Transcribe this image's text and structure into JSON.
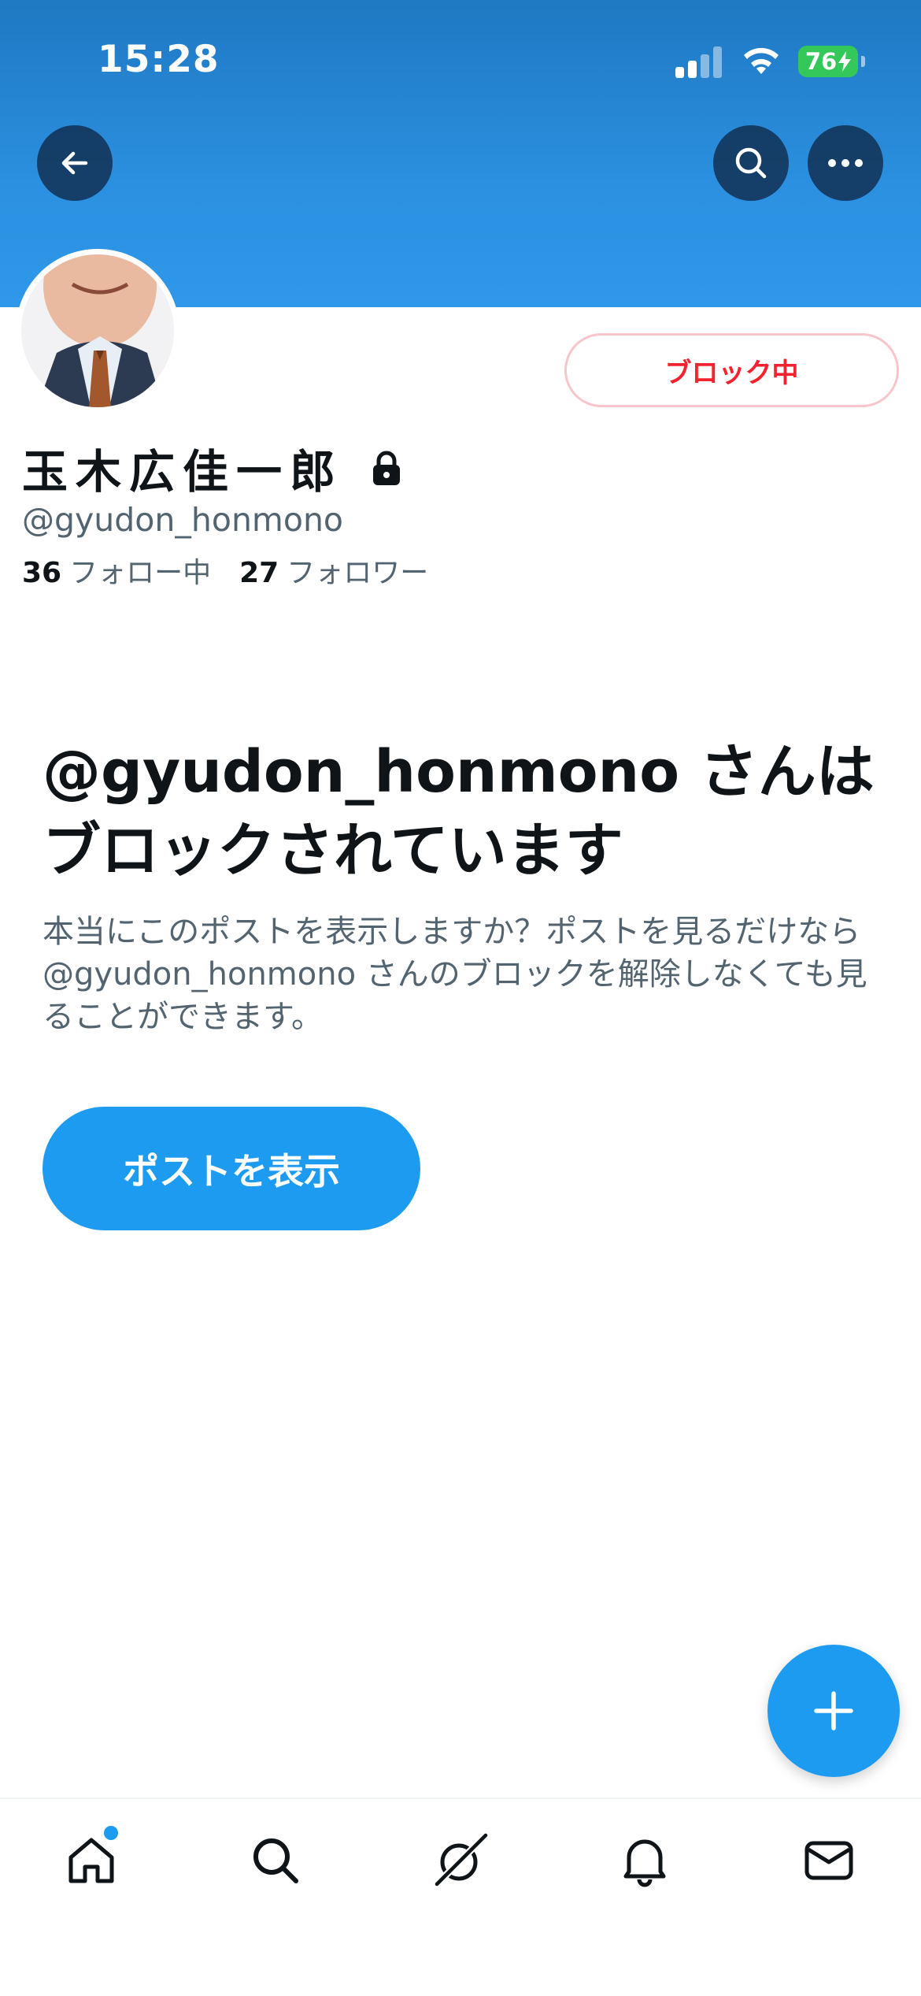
{
  "status_bar": {
    "time": "15:28",
    "battery": "76"
  },
  "header": {
    "back_icon": "arrow-left-icon",
    "search_icon": "search-icon",
    "more_icon": "more-horizontal-icon",
    "banner_color": "#2b90e0"
  },
  "profile": {
    "display_name": "玉木広佳一郎",
    "handle": "@gyudon_honmono",
    "following_count": "36",
    "following_label": "フォロー中",
    "followers_count": "27",
    "followers_label": "フォロワー",
    "protected_icon": "lock-icon",
    "blocked_button_label": "ブロック中"
  },
  "blocked_notice": {
    "title": "@gyudon_honmono さんはブロックされています",
    "description": "本当にこのポストを表示しますか？ポストを見るだけなら @gyudon_honmono さんのブロックを解除しなくても見ることができます。",
    "button_label": "ポストを表示"
  },
  "fab": {
    "icon": "plus-icon"
  },
  "tab_bar": {
    "items": [
      {
        "name": "home",
        "icon": "home-icon",
        "has_badge": true
      },
      {
        "name": "search",
        "icon": "search-icon"
      },
      {
        "name": "grok",
        "icon": "grok-icon"
      },
      {
        "name": "notifications",
        "icon": "bell-icon"
      },
      {
        "name": "messages",
        "icon": "mail-icon"
      }
    ]
  },
  "colors": {
    "accent": "#1d9bf0",
    "blocked_red": "#f4212e",
    "secondary_text": "#536471"
  }
}
